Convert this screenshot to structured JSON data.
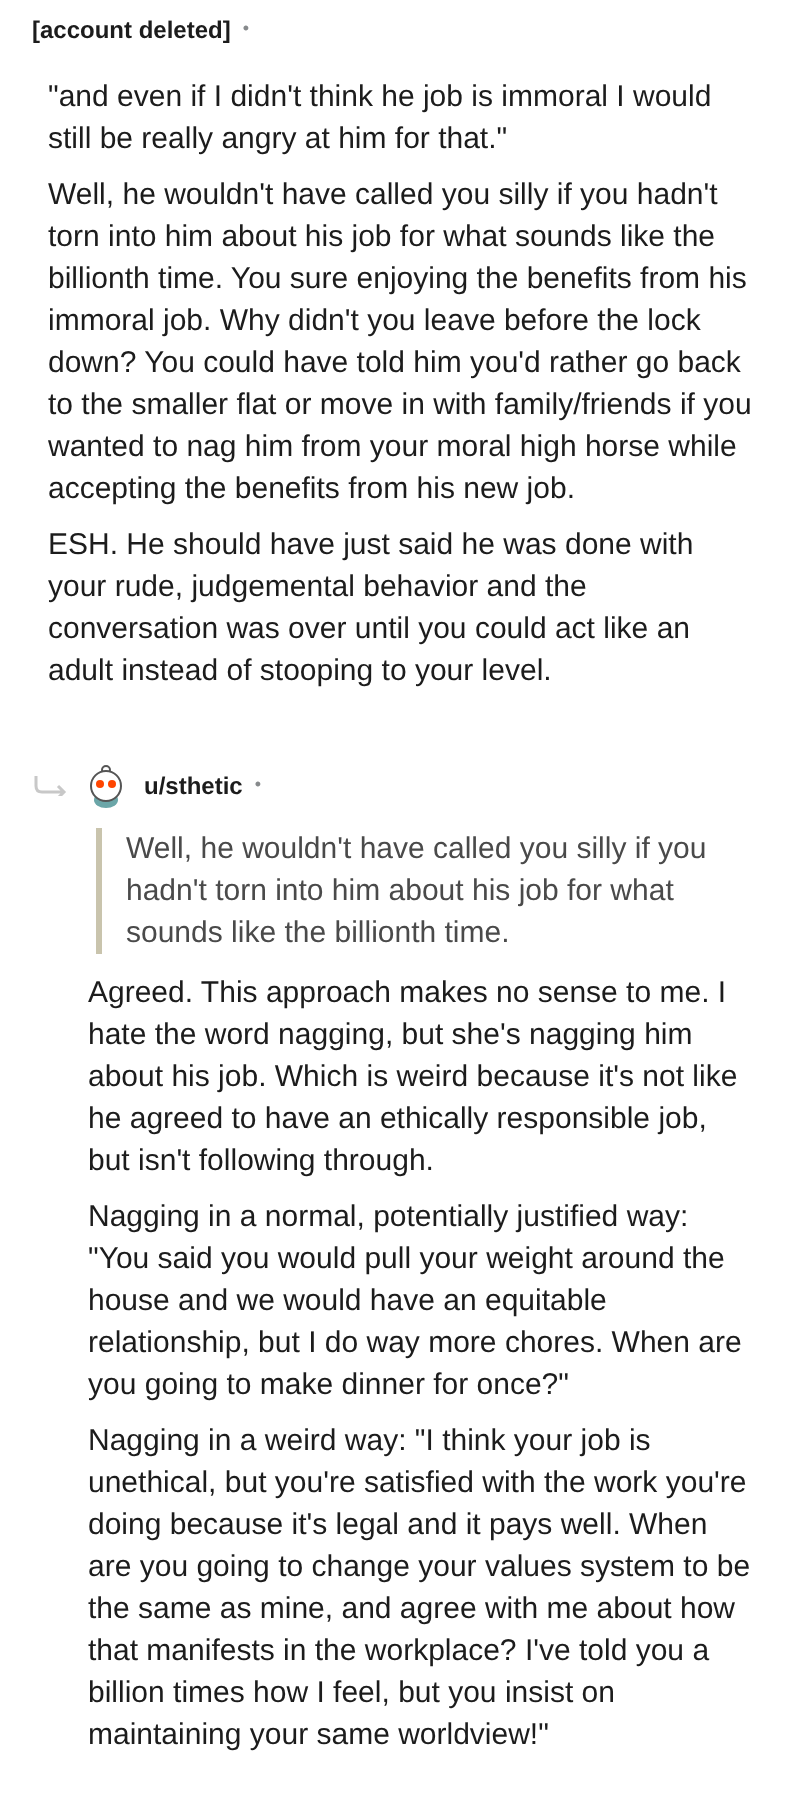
{
  "comments": [
    {
      "kind": "top",
      "author": "[account deleted]",
      "separator": "•",
      "paragraphs": [
        "\"and even if I didn't think he job is immoral I would still be really angry at him for that.\"",
        "Well, he wouldn't have called you silly if you hadn't torn into him about his job for what sounds like the billionth time. You sure enjoying the benefits from his immoral job. Why didn't you leave before the lock down? You could have told him you'd rather go back to the smaller flat or move in with family/friends if you wanted to nag him from your moral high horse while accepting the benefits from his new job.",
        "ESH. He should have just said he was done with your rude, judgemental behavior and the conversation was over until you could act like an adult instead of stooping to your level."
      ]
    },
    {
      "kind": "reply",
      "author": "u/sthetic",
      "separator": "•",
      "quote": "Well, he wouldn't have called you silly if you hadn't torn into him about his job for what sounds like the billionth time.",
      "paragraphs": [
        "Agreed. This approach makes no sense to me. I hate the word nagging, but she's nagging him about his job. Which is weird because it's not like he agreed to have an ethically responsible job, but isn't following through.",
        "Nagging in a normal, potentially justified way: \"You said you would pull your weight around the house and we would have an equitable relationship, but I do way more chores. When are you going to make dinner for once?\"",
        "Nagging in a weird way: \"I think your job is unethical, but you're satisfied with the work you're doing because it's legal and it pays well. When are you going to change your values system to be the same as mine, and agree with me about how that manifests in the workplace? I've told you a billion times how I feel, but you insist on maintaining your same worldview!\""
      ]
    }
  ]
}
